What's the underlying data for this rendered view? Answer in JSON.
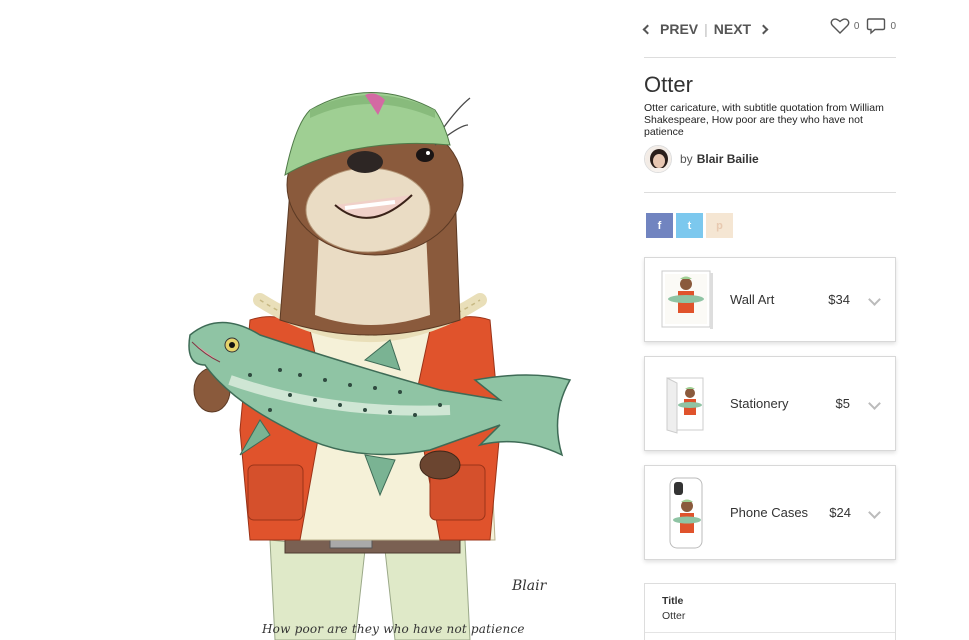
{
  "artwork": {
    "caption": "How poor are they who have not patience",
    "signature": "Blair"
  },
  "nav": {
    "prev": "PREV",
    "separator": "|",
    "next": "NEXT"
  },
  "counts": {
    "likes": "0",
    "comments": "0"
  },
  "product_info": {
    "title": "Otter",
    "description": "Otter caricature, with subtitle quotation from William Shakespeare, How poor are they who have not patience",
    "by_label": "by",
    "artist_name": "Blair Bailie"
  },
  "share": {
    "facebook": "f",
    "twitter": "t",
    "pinterest": "p"
  },
  "products": [
    {
      "name": "Wall Art",
      "price": "$34"
    },
    {
      "name": "Stationery",
      "price": "$5"
    },
    {
      "name": "Phone Cases",
      "price": "$24"
    }
  ],
  "details": {
    "label": "Title",
    "value": "Otter"
  },
  "colors": {
    "facebook": "#7184c0",
    "twitter": "#7cc8ee",
    "pinterest": "#f5e6d3",
    "vest": "#e0532c",
    "hat": "#9fcf93",
    "fish": "#8fc4a4"
  }
}
